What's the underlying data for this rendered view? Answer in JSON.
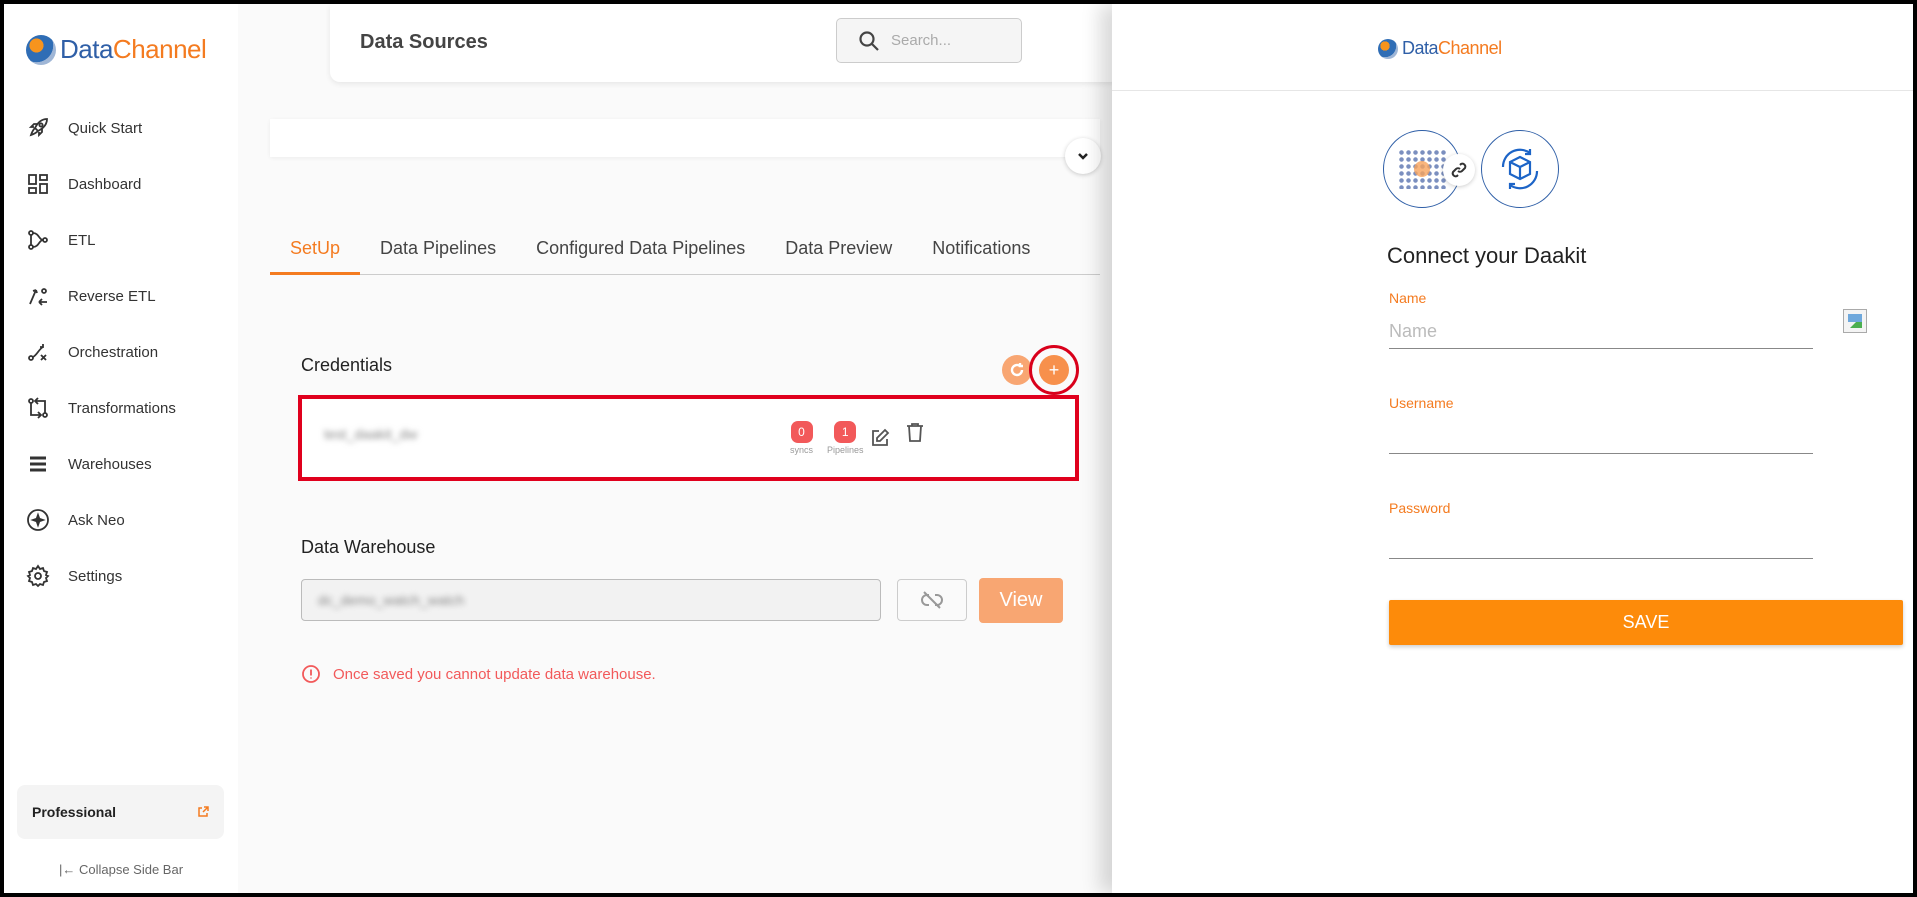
{
  "brand": {
    "name_part1": "Data",
    "name_part2": "Channel"
  },
  "sidebar": {
    "items": [
      {
        "label": "Quick Start",
        "icon": "rocket-icon"
      },
      {
        "label": "Dashboard",
        "icon": "dashboard-icon"
      },
      {
        "label": "ETL",
        "icon": "etl-icon"
      },
      {
        "label": "Reverse ETL",
        "icon": "reverse-etl-icon"
      },
      {
        "label": "Orchestration",
        "icon": "orchestration-icon"
      },
      {
        "label": "Transformations",
        "icon": "transformations-icon"
      },
      {
        "label": "Warehouses",
        "icon": "warehouses-icon"
      },
      {
        "label": "Ask Neo",
        "icon": "sparkle-icon"
      },
      {
        "label": "Settings",
        "icon": "gear-icon"
      }
    ],
    "plan": "Professional",
    "collapse_label": "Collapse Side Bar"
  },
  "header": {
    "title": "Data Sources",
    "search_placeholder": "Search..."
  },
  "tabs": [
    {
      "label": "SetUp",
      "active": true
    },
    {
      "label": "Data Pipelines",
      "active": false
    },
    {
      "label": "Configured Data Pipelines",
      "active": false
    },
    {
      "label": "Data Preview",
      "active": false
    },
    {
      "label": "Notifications",
      "active": false
    }
  ],
  "credentials": {
    "title": "Credentials",
    "row": {
      "name": "test_daakit_dw",
      "syncs_count": "0",
      "syncs_label": "syncs",
      "pipelines_count": "1",
      "pipelines_label": "Pipelines"
    }
  },
  "warehouse": {
    "title": "Data Warehouse",
    "value": "dc_demo_watch_watch",
    "view_label": "View",
    "warning": "Once saved you cannot update data warehouse."
  },
  "panel": {
    "title": "Connect your Daakit",
    "fields": [
      {
        "label": "Name",
        "placeholder": "Name",
        "value": ""
      },
      {
        "label": "Username",
        "placeholder": "",
        "value": ""
      },
      {
        "label": "Password",
        "placeholder": "",
        "value": ""
      }
    ],
    "save_label": "SAVE"
  },
  "colors": {
    "accent": "#f47b20",
    "brand_blue": "#2f5fa7",
    "highlight": "#e0001d",
    "badge": "#f2595a"
  }
}
